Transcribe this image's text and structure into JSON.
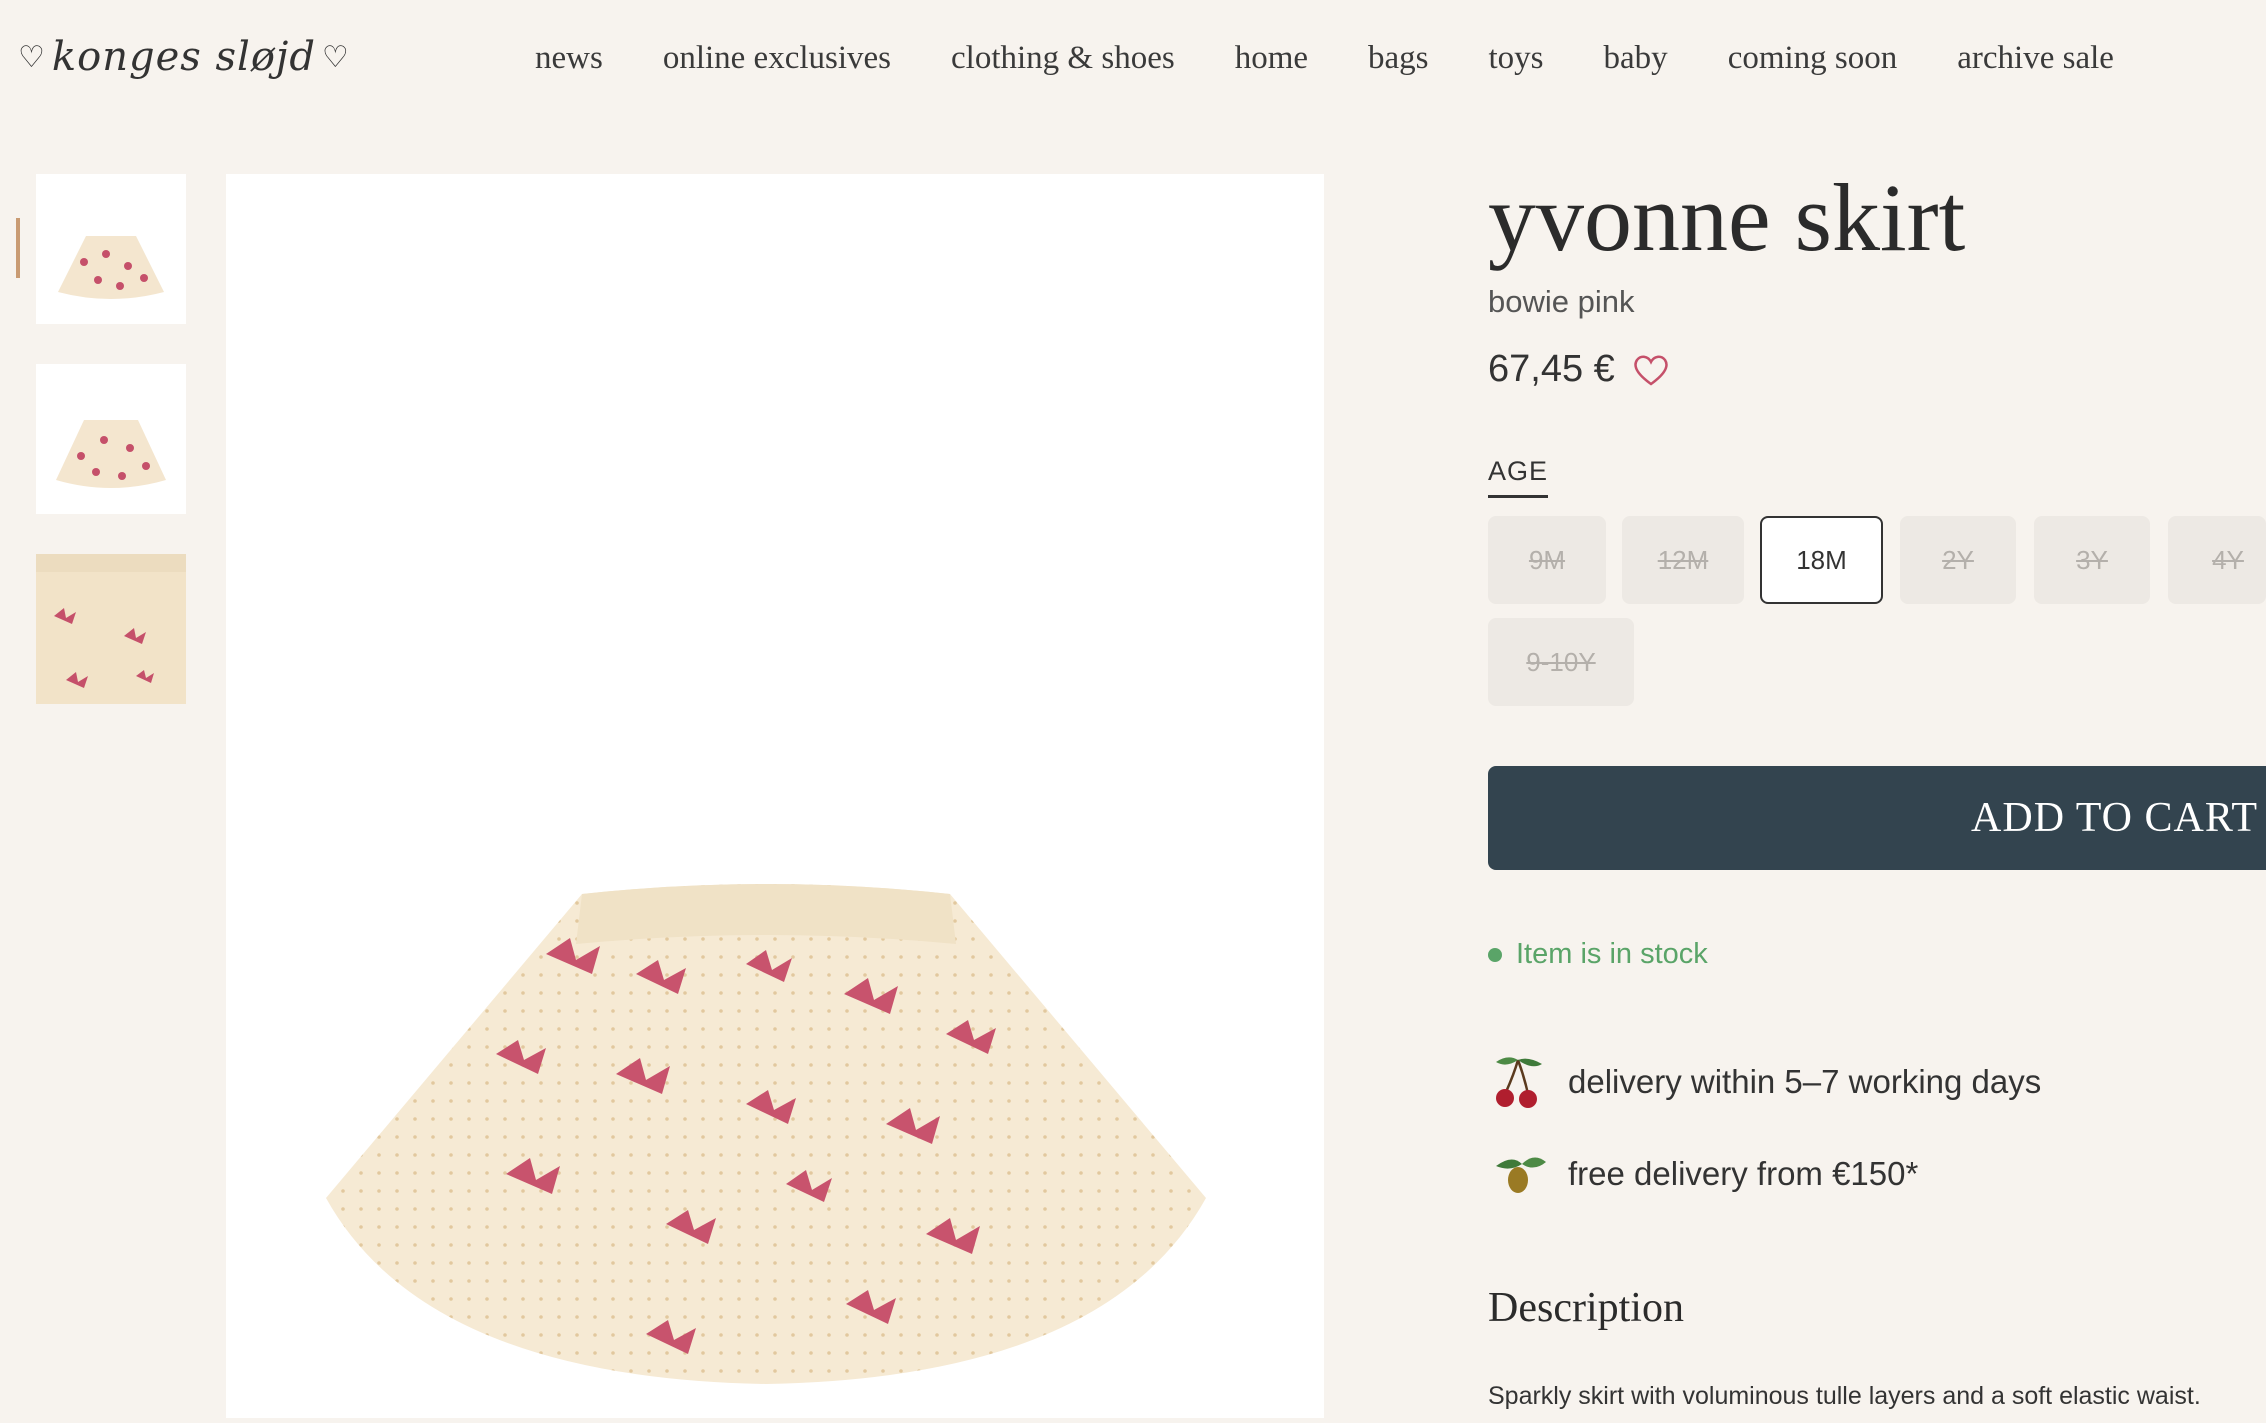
{
  "brand": {
    "logo_text": "konges sløjd"
  },
  "nav": {
    "items": [
      "news",
      "online exclusives",
      "clothing & shoes",
      "home",
      "bags",
      "toys",
      "baby",
      "coming soon",
      "archive sale"
    ]
  },
  "product": {
    "title": "yvonne skirt",
    "variant": "bowie pink",
    "price": "67,45 €",
    "age_label": "AGE",
    "sizes": [
      "9M",
      "12M",
      "18M",
      "2Y",
      "3Y",
      "4Y",
      "9-10Y"
    ],
    "selected_size": "18M",
    "add_to_cart": "ADD TO CART",
    "stock_status": "Item is in stock",
    "delivery_info": "delivery within 5–7 working days",
    "free_delivery": "free delivery from €150*",
    "description_title": "Description",
    "description_text": "Sparkly skirt with voluminous tulle layers and a soft elastic waist."
  },
  "colors": {
    "background": "#f7f3ee",
    "cart_button": "#33444f",
    "in_stock": "#5aa468",
    "accent": "#c99b73"
  },
  "icons": [
    "heart-icon",
    "cherry-icon",
    "olive-icon"
  ]
}
